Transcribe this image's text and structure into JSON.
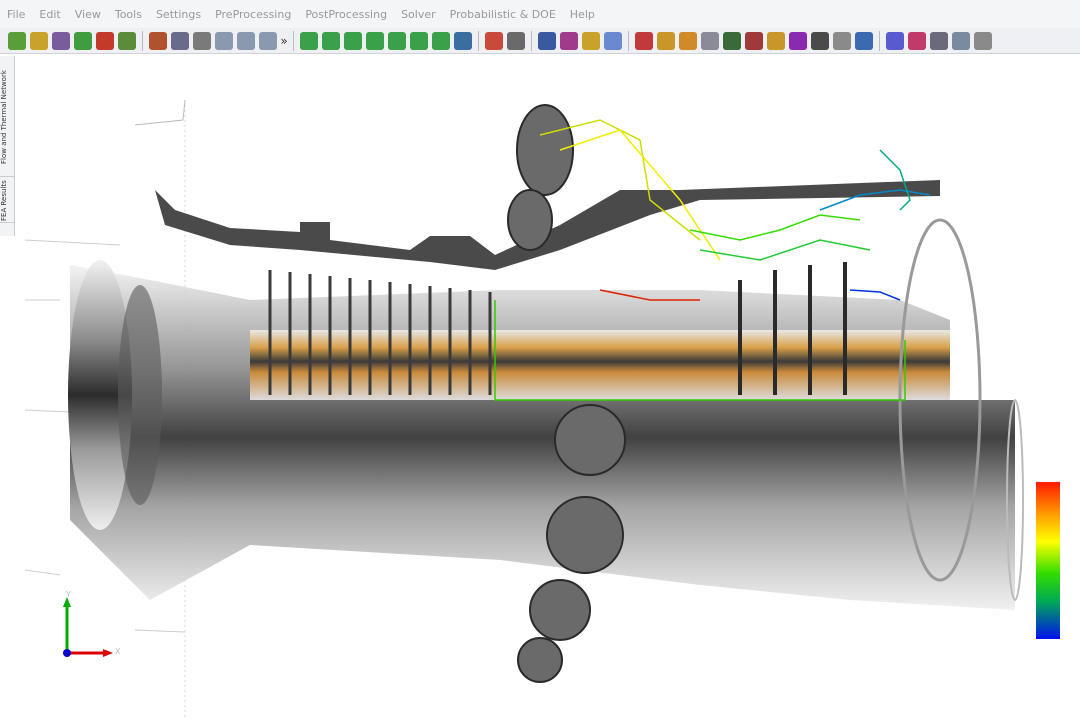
{
  "menubar": {
    "items": [
      "File",
      "Edit",
      "View",
      "Tools",
      "Settings",
      "PreProcessing",
      "PostProcessing",
      "Solver",
      "Probabilistic & DOE",
      "Help"
    ]
  },
  "toolbar": {
    "overflow_glyph": "»",
    "groups": [
      [
        {
          "name": "open-model-icon",
          "color": "#5a9e3a"
        },
        {
          "name": "import-icon",
          "color": "#c9a22a"
        },
        {
          "name": "save-icon",
          "color": "#7a5c9e"
        },
        {
          "name": "mesh-green-icon",
          "color": "#3f9c3f"
        },
        {
          "name": "mesh-red-icon",
          "color": "#c33a2a"
        },
        {
          "name": "user-icon",
          "color": "#5c8c3a"
        }
      ],
      [
        {
          "name": "select-points-icon",
          "color": "#b0522e"
        },
        {
          "name": "select-box-icon",
          "color": "#6a6a8a"
        },
        {
          "name": "select-region-icon",
          "color": "#7a7a7a"
        },
        {
          "name": "zoom-window-icon",
          "color": "#8a98b0"
        },
        {
          "name": "zoom-in-icon",
          "color": "#8a98b0"
        },
        {
          "name": "zoom-out-icon",
          "color": "#8a98b0"
        }
      ],
      [
        {
          "name": "view-x-icon",
          "color": "#3aa04a"
        },
        {
          "name": "view-neg-x-icon",
          "color": "#3aa04a"
        },
        {
          "name": "view-y-icon",
          "color": "#3aa04a"
        },
        {
          "name": "view-neg-y-icon",
          "color": "#3aa04a"
        },
        {
          "name": "view-z-icon",
          "color": "#3aa04a"
        },
        {
          "name": "view-neg-z-icon",
          "color": "#3aa04a"
        },
        {
          "name": "view-iso-icon",
          "color": "#3aa04a"
        },
        {
          "name": "monitor-icon",
          "color": "#3a6ea0"
        }
      ],
      [
        {
          "name": "chart-icon",
          "color": "#c94a3a"
        },
        {
          "name": "table-icon",
          "color": "#6a6a6a"
        }
      ],
      [
        {
          "name": "line-tool-icon",
          "color": "#3a5aa0"
        },
        {
          "name": "node-tool-icon",
          "color": "#a03a8a"
        },
        {
          "name": "spline-tool-icon",
          "color": "#c9a22a"
        },
        {
          "name": "pipe-tool-icon",
          "color": "#6a8ad0"
        }
      ],
      [
        {
          "name": "draw-line-icon",
          "color": "#c03a3a"
        },
        {
          "name": "hierarchy-icon",
          "color": "#c9962a"
        },
        {
          "name": "solid-icon",
          "color": "#d08a2a"
        },
        {
          "name": "cube-icon",
          "color": "#8a8a9a"
        },
        {
          "name": "rgb-cube-icon",
          "color": "#3a6a3a"
        },
        {
          "name": "graph-icon",
          "color": "#a03a3a"
        },
        {
          "name": "layers-icon",
          "color": "#c9962a"
        },
        {
          "name": "curve-icon",
          "color": "#8a2ab0"
        },
        {
          "name": "sigma-icon",
          "color": "#4a4a4a"
        },
        {
          "name": "tools-icon",
          "color": "#8a8a8a"
        },
        {
          "name": "refresh-icon",
          "color": "#3a6ab0"
        }
      ],
      [
        {
          "name": "color-map-icon",
          "color": "#5a5ad0"
        },
        {
          "name": "results-icon",
          "color": "#c03a6a"
        },
        {
          "name": "eye-icon",
          "color": "#6a6a7a"
        },
        {
          "name": "help-icon",
          "color": "#7a8aa0"
        },
        {
          "name": "settings-icon",
          "color": "#8a8a8a"
        }
      ]
    ]
  },
  "side_tabs": {
    "fea_results": "FEA Results",
    "flow_thermal": "Flow and Thermal Network"
  },
  "viewport": {
    "axis_x_label": "X",
    "axis_y_label": "Y",
    "legend_gradient": [
      "#ff1a00",
      "#ff9900",
      "#ffff00",
      "#33dd00",
      "#00aa55",
      "#0011ee"
    ]
  }
}
